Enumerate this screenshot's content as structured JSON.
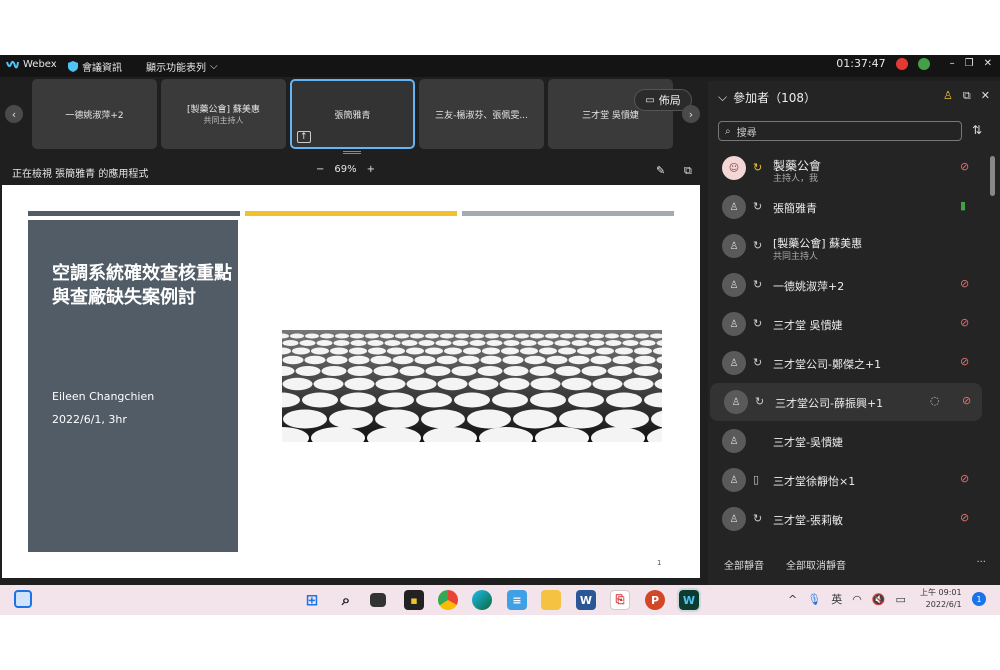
{
  "titlebar": {
    "app_name": "Webex",
    "meeting_info": "會議資訊",
    "menu_label": "顯示功能表列",
    "clock": "01:37:47",
    "colors": {
      "brand": "#4fc3f7",
      "recording": "#e53935",
      "stats": "#43a047"
    }
  },
  "strip": {
    "tiles": [
      {
        "name": "一德姚淑萍+2",
        "sub": ""
      },
      {
        "name": "[製藥公會] 蘇美惠",
        "sub": "共同主持人"
      },
      {
        "name": "張簡雅青",
        "sub": ""
      },
      {
        "name": "三友-楊淑芬、張佩雯...",
        "sub": ""
      },
      {
        "name": "三才堂 吳憒婕",
        "sub": ""
      }
    ],
    "layout_label": "佈局"
  },
  "sharebar": {
    "viewing_text": "正在檢視 張簡雅青 的應用程式",
    "zoom_minus": "−",
    "zoom_value": "69%",
    "zoom_plus": "+"
  },
  "slide": {
    "title": "空調系統確效查核重點與查廠缺失案例討",
    "author": "Eileen Changchien",
    "date": "2022/6/1, 3hr",
    "page": "1",
    "colors": {
      "panel": "#525c66",
      "bar1": "#525c66",
      "bar2": "#f2c12e",
      "bar3": "#a5a9b0"
    }
  },
  "participants": {
    "header": "參加者（108）",
    "search_placeholder": "搜尋",
    "rows": [
      {
        "name": "製藥公會",
        "role": "主持人，我",
        "mic": "muted"
      },
      {
        "name": "張簡雅青",
        "role": "",
        "mic": "on"
      },
      {
        "name": "[製藥公會] 蘇美惠",
        "role": "共同主持人",
        "mic": "none"
      },
      {
        "name": "一德姚淑萍+2",
        "role": "",
        "mic": "muted"
      },
      {
        "name": "三才堂 吳憒婕",
        "role": "",
        "mic": "muted"
      },
      {
        "name": "三才堂公司-鄭傑之+1",
        "role": "",
        "mic": "muted"
      },
      {
        "name": "三才堂公司-薛振興+1",
        "role": "",
        "mic": "muted"
      },
      {
        "name": "三才堂-吳憒婕",
        "role": "",
        "mic": "none"
      },
      {
        "name": "三才堂徐靜怡×1",
        "role": "",
        "mic": "muted"
      },
      {
        "name": "三才堂-張莉敏",
        "role": "",
        "mic": "muted"
      }
    ],
    "mute_all": "全部靜音",
    "unmute_all": "全部取消靜音",
    "more": "···"
  },
  "taskbar": {
    "ime": "英",
    "clock_line1": "上午 09:01",
    "clock_line2": "2022/6/1",
    "notifications": "1"
  }
}
